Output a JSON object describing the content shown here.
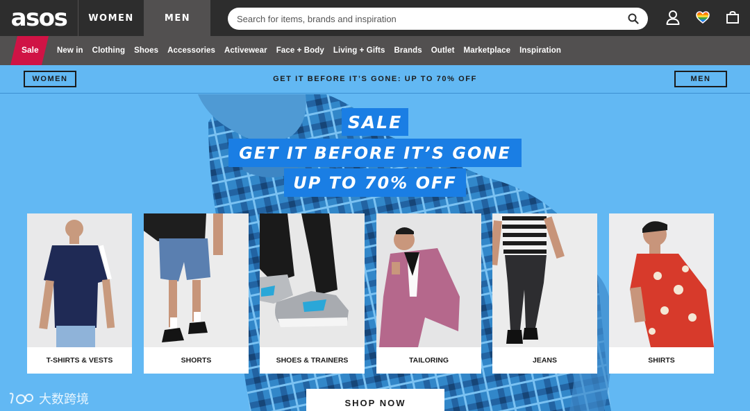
{
  "header": {
    "logo": "asos",
    "tabs": [
      "WOMEN",
      "MEN"
    ],
    "active_tab": "MEN",
    "search_placeholder": "Search for items, brands and inspiration",
    "icons": [
      "search-icon",
      "account-icon",
      "saved-items-heart-icon",
      "bag-icon"
    ]
  },
  "nav": {
    "sale": "Sale",
    "items": [
      "New in",
      "Clothing",
      "Shoes",
      "Accessories",
      "Activewear",
      "Face + Body",
      "Living + Gifts",
      "Brands",
      "Outlet",
      "Marketplace",
      "Inspiration"
    ]
  },
  "promo": {
    "women_button": "WOMEN",
    "text": "GET IT BEFORE IT’S GONE: UP TO 70% OFF",
    "men_button": "MEN"
  },
  "hero": {
    "line1": "SALE",
    "line2": "GET IT BEFORE IT’S GONE",
    "line3": "UP TO 70% OFF",
    "cards": [
      {
        "label": "T-SHIRTS & VESTS"
      },
      {
        "label": "SHORTS"
      },
      {
        "label": "SHOES & TRAINERS"
      },
      {
        "label": "TAILORING"
      },
      {
        "label": "JEANS"
      },
      {
        "label": "SHIRTS"
      }
    ],
    "cta": "SHOP NOW"
  },
  "watermark": "大数跨境",
  "colors": {
    "header_bg": "#2d2d2d",
    "nav_bg": "#525050",
    "sale_red": "#d01345",
    "sky_blue": "#62b8f3",
    "headline_blue": "#1a7ee4"
  }
}
